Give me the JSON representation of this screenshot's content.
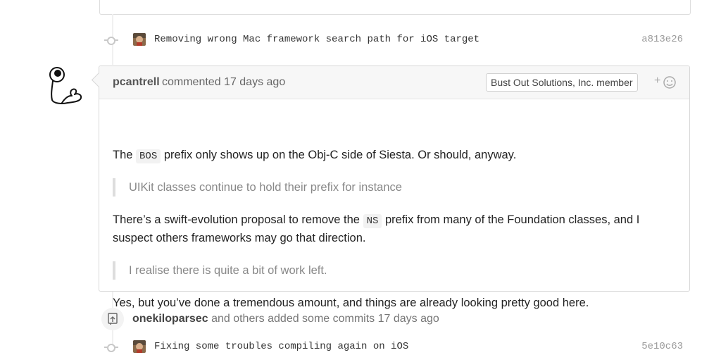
{
  "commits": [
    {
      "message": "Removing wrong Mac framework search path for iOS target",
      "sha": "a813e26"
    },
    {
      "message": "Fixing some troubles compiling again on iOS",
      "sha": "5e10c63"
    }
  ],
  "comment": {
    "author": "pcantrell",
    "action": "commented 17 days ago",
    "badge": "Bust Out Solutions, Inc. member",
    "reaction_plus": "+",
    "p1": {
      "before": "The",
      "code": "BOS",
      "after": "prefix only shows up on the Obj-C side of Siesta. Or should, anyway."
    },
    "quote1": "UIKit classes continue to hold their prefix for instance",
    "p2": {
      "before": "There’s a swift-evolution proposal to remove the",
      "code": "NS",
      "after_line1": "prefix from many of the Foundation classes, and I",
      "line2": "suspect others frameworks may go that direction."
    },
    "quote2": "I realise there is quite a bit of work left.",
    "p3": "Yes, but you’ve done a tremendous amount, and things are already looking pretty good here."
  },
  "event": {
    "actor": "onekiloparsec",
    "text": "and others added some commits 17 days ago"
  },
  "icons": {
    "commit_node": "git-commit-icon",
    "reaction": "smiley-icon",
    "event": "repo-push-icon"
  }
}
